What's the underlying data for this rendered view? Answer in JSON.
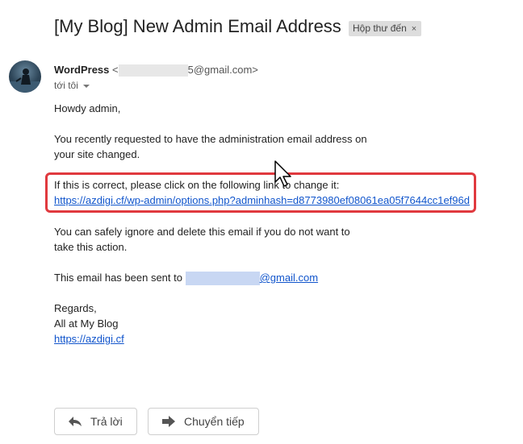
{
  "email": {
    "subject": "[My Blog] New Admin Email Address",
    "label": "Hộp thư đến",
    "label_close": "×",
    "sender_name": "WordPress",
    "sender_addr_open": "<",
    "sender_addr_tail": "5@gmail.com>",
    "to_text": "tới tôi",
    "greeting": "Howdy admin,",
    "para1_line1": "You recently requested to have the administration email address on",
    "para1_line2": "your site changed.",
    "para2_line1": "If this is correct, please click on the following link to change it:",
    "confirm_link": "https://azdigi.cf/wp-admin/options.php?adminhash=d8773980ef08061ea05f7644cc1ef96d",
    "para3_line1": "You can safely ignore and delete this email if you do not want to",
    "para3_line2": "take this action.",
    "sent_to_prefix": "This email has been sent to",
    "sent_to_tail": "@gmail.com",
    "regards": "Regards,",
    "signoff": "All at My Blog",
    "site_link": "https://azdigi.cf"
  },
  "actions": {
    "reply_label": "Trả lời",
    "forward_label": "Chuyển tiếp"
  },
  "icons": {
    "reply": "reply-icon",
    "forward": "forward-icon",
    "cursor": "mouse-pointer-icon"
  },
  "colors": {
    "link": "#1155cc",
    "highlight": "#e0393e"
  }
}
